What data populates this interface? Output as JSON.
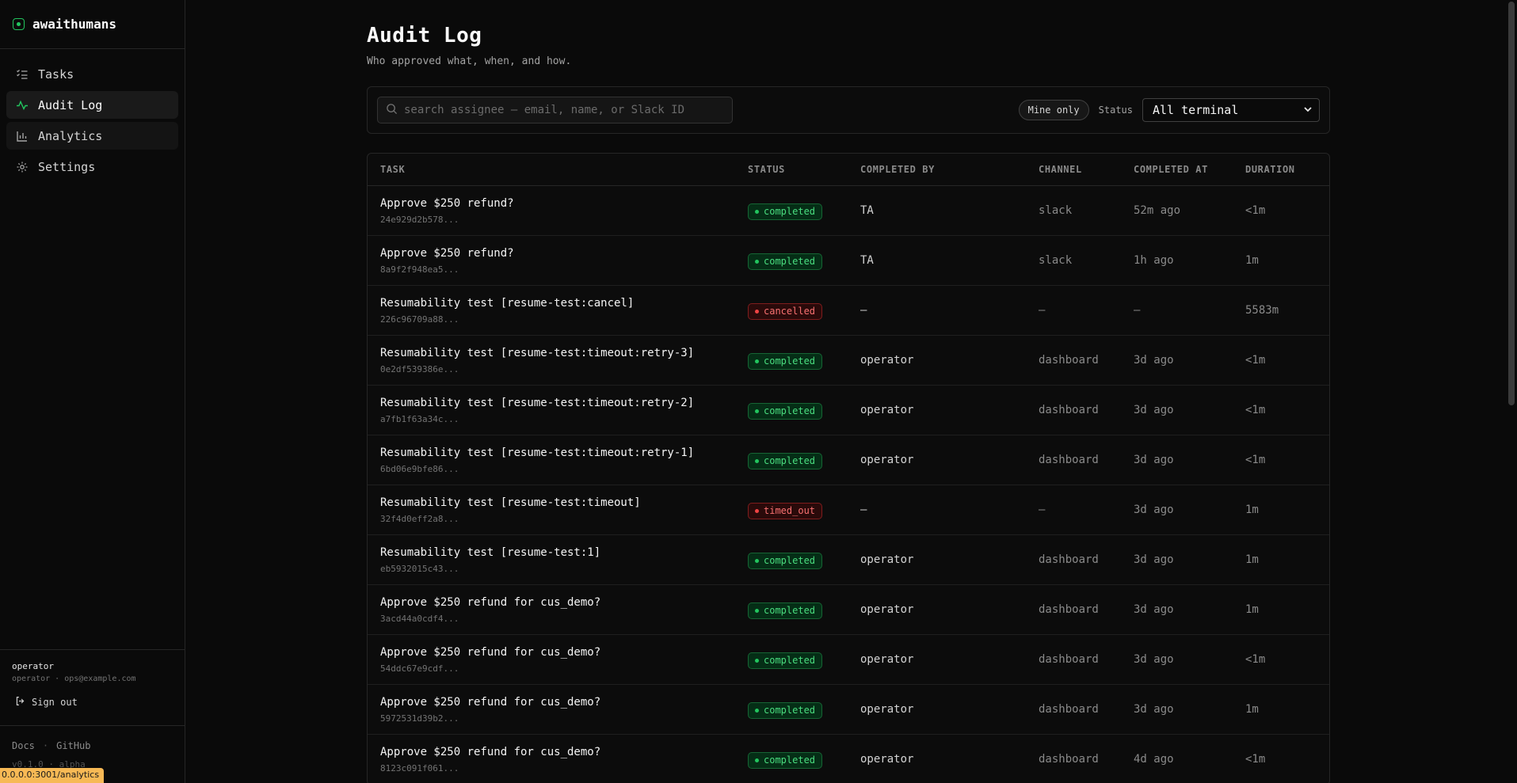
{
  "brand": {
    "name": "awaithumans"
  },
  "nav": [
    {
      "label": "Tasks",
      "icon": "list-check-icon",
      "name": "sidebar-item-tasks",
      "state": ""
    },
    {
      "label": "Audit Log",
      "icon": "activity-icon",
      "name": "sidebar-item-audit-log",
      "state": "active"
    },
    {
      "label": "Analytics",
      "icon": "bar-chart-icon",
      "name": "sidebar-item-analytics",
      "state": "hover"
    },
    {
      "label": "Settings",
      "icon": "gear-icon",
      "name": "sidebar-item-settings",
      "state": ""
    }
  ],
  "user": {
    "name": "operator",
    "meta": "operator · ops@example.com",
    "signout": "Sign out"
  },
  "footer": {
    "docs": "Docs",
    "sep": "·",
    "github": "GitHub",
    "version": "v0.1.0 · alpha"
  },
  "status_url": "0.0.0.0:3001/analytics",
  "page": {
    "title": "Audit Log",
    "subtitle": "Who approved what, when, and how."
  },
  "filters": {
    "search_placeholder": "search assignee — email, name, or Slack ID",
    "mine_only": "Mine only",
    "status_label": "Status",
    "status_value": "All terminal"
  },
  "table": {
    "headers": [
      "TASK",
      "STATUS",
      "COMPLETED BY",
      "CHANNEL",
      "COMPLETED AT",
      "DURATION"
    ],
    "rows": [
      {
        "task": "Approve $250 refund?",
        "id": "24e929d2b578...",
        "status": "completed",
        "by": "TA",
        "channel": "slack",
        "at": "52m ago",
        "duration": "<1m"
      },
      {
        "task": "Approve $250 refund?",
        "id": "8a9f2f948ea5...",
        "status": "completed",
        "by": "TA",
        "channel": "slack",
        "at": "1h ago",
        "duration": "1m"
      },
      {
        "task": "Resumability test [resume-test:cancel]",
        "id": "226c96709a88...",
        "status": "cancelled",
        "by": "—",
        "channel": "—",
        "at": "—",
        "duration": "5583m"
      },
      {
        "task": "Resumability test [resume-test:timeout:retry-3]",
        "id": "0e2df539386e...",
        "status": "completed",
        "by": "operator",
        "channel": "dashboard",
        "at": "3d ago",
        "duration": "<1m"
      },
      {
        "task": "Resumability test [resume-test:timeout:retry-2]",
        "id": "a7fb1f63a34c...",
        "status": "completed",
        "by": "operator",
        "channel": "dashboard",
        "at": "3d ago",
        "duration": "<1m"
      },
      {
        "task": "Resumability test [resume-test:timeout:retry-1]",
        "id": "6bd06e9bfe86...",
        "status": "completed",
        "by": "operator",
        "channel": "dashboard",
        "at": "3d ago",
        "duration": "<1m"
      },
      {
        "task": "Resumability test [resume-test:timeout]",
        "id": "32f4d0eff2a8...",
        "status": "timed_out",
        "by": "—",
        "channel": "—",
        "at": "3d ago",
        "duration": "1m"
      },
      {
        "task": "Resumability test [resume-test:1]",
        "id": "eb5932015c43...",
        "status": "completed",
        "by": "operator",
        "channel": "dashboard",
        "at": "3d ago",
        "duration": "1m"
      },
      {
        "task": "Approve $250 refund for cus_demo?",
        "id": "3acd44a0cdf4...",
        "status": "completed",
        "by": "operator",
        "channel": "dashboard",
        "at": "3d ago",
        "duration": "1m"
      },
      {
        "task": "Approve $250 refund for cus_demo?",
        "id": "54ddc67e9cdf...",
        "status": "completed",
        "by": "operator",
        "channel": "dashboard",
        "at": "3d ago",
        "duration": "<1m"
      },
      {
        "task": "Approve $250 refund for cus_demo?",
        "id": "5972531d39b2...",
        "status": "completed",
        "by": "operator",
        "channel": "dashboard",
        "at": "3d ago",
        "duration": "1m"
      },
      {
        "task": "Approve $250 refund for cus_demo?",
        "id": "8123c091f061...",
        "status": "completed",
        "by": "operator",
        "channel": "dashboard",
        "at": "4d ago",
        "duration": "<1m"
      }
    ]
  },
  "colors": {
    "accent": "#22c55e",
    "danger": "#ef4444",
    "background": "#0a0a0a"
  }
}
